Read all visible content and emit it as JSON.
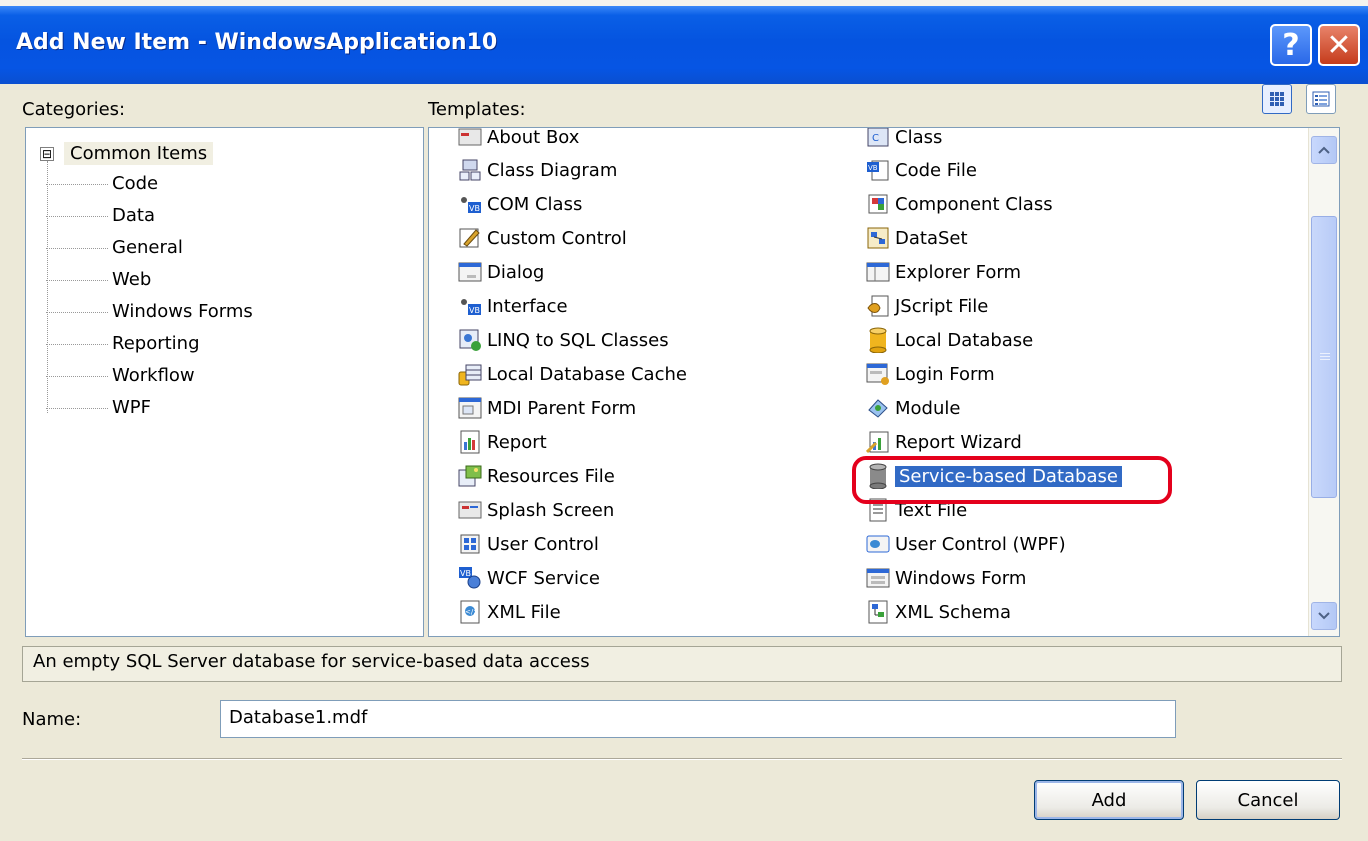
{
  "dialog": {
    "title": "Add New Item - WindowsApplication10",
    "help_glyph": "?",
    "close_glyph": "✕"
  },
  "categories": {
    "label": "Categories:",
    "root": {
      "expander": "⊟",
      "label": "Common Items"
    },
    "items": [
      "Code",
      "Data",
      "General",
      "Web",
      "Windows Forms",
      "Reporting",
      "Workflow",
      "WPF"
    ]
  },
  "templates": {
    "label": "Templates:",
    "left": [
      "About Box",
      "Class Diagram",
      "COM Class",
      "Custom Control",
      "Dialog",
      "Interface",
      "LINQ to SQL Classes",
      "Local Database Cache",
      "MDI Parent Form",
      "Report",
      "Resources File",
      "Splash Screen",
      "User Control",
      "WCF Service",
      "XML File"
    ],
    "right": [
      "Class",
      "Code File",
      "Component Class",
      "DataSet",
      "Explorer Form",
      "JScript File",
      "Local Database",
      "Login Form",
      "Module",
      "Report Wizard",
      "Service-based Database",
      "Text File",
      "User Control (WPF)",
      "Windows Form",
      "XML Schema"
    ],
    "selected": "Service-based Database",
    "colors": {
      "selected_bg": "#316ac5",
      "highlight_ring": "#e4001c"
    }
  },
  "description": "An empty SQL Server database for service-based data access",
  "name_field": {
    "label": "Name:",
    "value": "Database1.mdf"
  },
  "buttons": {
    "add": "Add",
    "cancel": "Cancel"
  }
}
